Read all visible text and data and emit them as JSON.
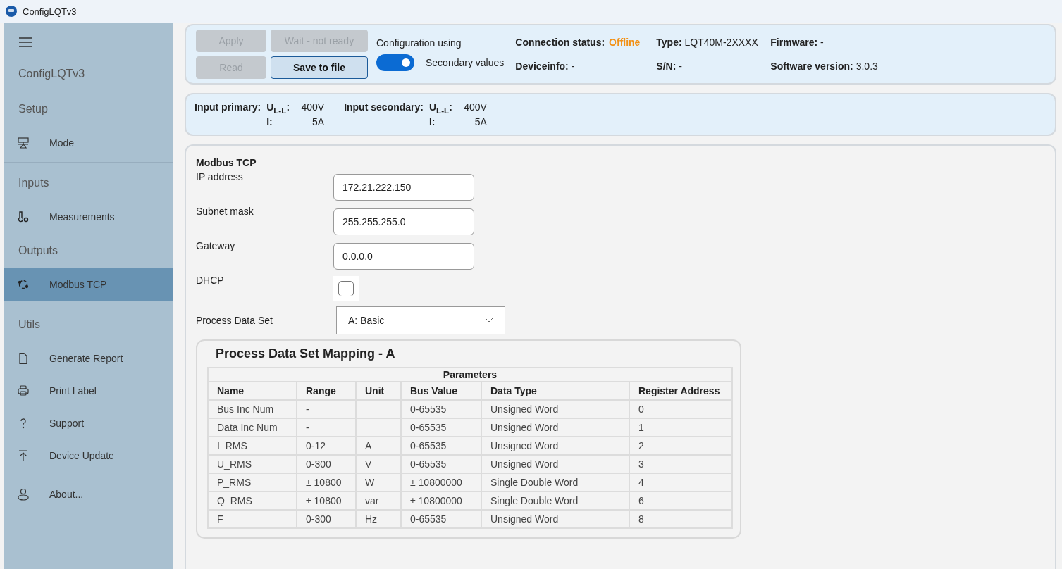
{
  "window": {
    "title": "ConfigLQTv3"
  },
  "sidebar": {
    "groups": [
      {
        "items": [
          {
            "kind": "title",
            "label": "ConfigLQTv3"
          },
          {
            "kind": "section",
            "label": "Setup"
          },
          {
            "kind": "nav",
            "label": "Mode",
            "selected": false
          }
        ]
      },
      {
        "items": [
          {
            "kind": "section",
            "label": "Inputs"
          },
          {
            "kind": "nav",
            "label": "Measurements",
            "selected": false
          },
          {
            "kind": "section",
            "label": "Outputs"
          },
          {
            "kind": "nav",
            "label": "Modbus TCP",
            "selected": true
          }
        ]
      },
      {
        "items": [
          {
            "kind": "section",
            "label": "Utils"
          },
          {
            "kind": "nav",
            "label": "Generate Report",
            "selected": false
          },
          {
            "kind": "nav",
            "label": "Print Label",
            "selected": false
          },
          {
            "kind": "nav",
            "label": "Support",
            "selected": false
          },
          {
            "kind": "nav",
            "label": "Device Update",
            "selected": false
          }
        ]
      },
      {
        "items": [
          {
            "kind": "nav",
            "label": "About...",
            "selected": false
          }
        ]
      }
    ]
  },
  "toolbar": {
    "buttons": [
      {
        "label": "Apply",
        "disabled": true
      },
      {
        "label": "Wait - not ready",
        "disabled": true
      },
      {
        "label": "Read",
        "disabled": true
      },
      {
        "label": "Save to file",
        "disabled": false
      }
    ],
    "config_label": "Configuration using",
    "toggle": {
      "label": "Secondary values",
      "on": true
    },
    "info": [
      {
        "kind": "status",
        "label": "Connection status:",
        "value": "Offline"
      },
      {
        "kind": "field",
        "text": "**Type:** LQT40M-2XXXX"
      },
      {
        "kind": "field",
        "text": "**Firmware:** -"
      },
      {
        "kind": "field",
        "text": "**Deviceinfo:** -"
      },
      {
        "kind": "field",
        "text": "**S/N:** -"
      },
      {
        "kind": "field",
        "text": "**Software version:** 3.0.3"
      }
    ]
  },
  "inputs": [
    {
      "label": "Input primary:",
      "lines": [
        [
          "U$_{L-L}$:",
          "400V"
        ],
        [
          "I:",
          "5A"
        ]
      ]
    },
    {
      "label": "Input secondary:",
      "lines": [
        [
          "U$_{L-L}$:",
          "400V"
        ],
        [
          "I:",
          "5A"
        ]
      ]
    }
  ],
  "modbus": {
    "title": "Modbus TCP",
    "fields": [
      {
        "label": "IP address",
        "value": "172.21.222.150"
      },
      {
        "label": "Subnet mask",
        "value": "255.255.255.0"
      },
      {
        "label": "Gateway",
        "value": "0.0.0.0"
      }
    ],
    "dhcp": {
      "label": "DHCP",
      "checked": false
    },
    "process_data_set": {
      "label": "Process Data Set",
      "value": "A: Basic"
    }
  },
  "mapping": {
    "title": "Process Data Set Mapping - A",
    "group_header": "Parameters",
    "columns": [
      "Name",
      "Range",
      "Unit",
      "Bus Value",
      "Data Type",
      "Register Address"
    ],
    "rows": [
      [
        "Bus Inc Num",
        "-",
        "",
        "0-65535",
        "Unsigned Word",
        "0"
      ],
      [
        "Data Inc Num",
        "-",
        "",
        "0-65535",
        "Unsigned Word",
        "1"
      ],
      [
        "I_RMS",
        "0-12",
        "A",
        "0-65535",
        "Unsigned Word",
        "2"
      ],
      [
        "U_RMS",
        "0-300",
        "V",
        "0-65535",
        "Unsigned Word",
        "3"
      ],
      [
        "P_RMS",
        "± 10800",
        "W",
        "± 10800000",
        "Single Double Word",
        "4"
      ],
      [
        "Q_RMS",
        "± 10800",
        "var",
        "± 10800000",
        "Single Double Word",
        "6"
      ],
      [
        "F",
        "0-300",
        "Hz",
        "0-65535",
        "Unsigned Word",
        "8"
      ]
    ]
  }
}
